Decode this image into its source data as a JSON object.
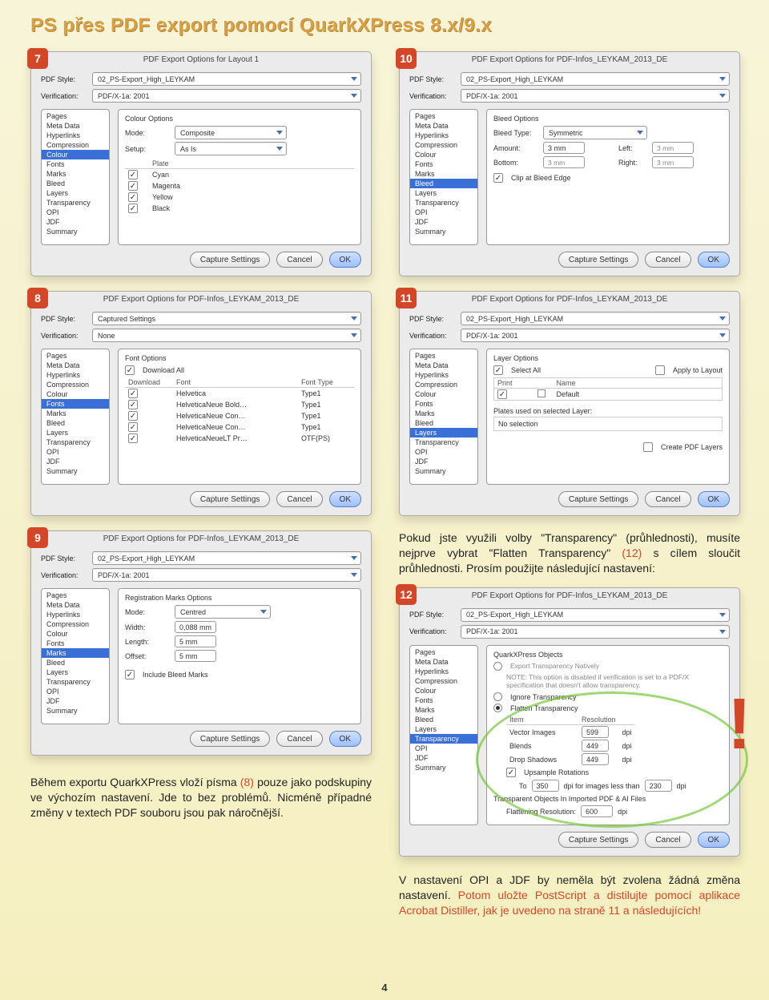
{
  "page_title": "PS přes PDF export pomocí QuarkXPress 8.x/9.x",
  "page_number": "4",
  "sidebar_items": [
    "Pages",
    "Meta Data",
    "Hyperlinks",
    "Compression",
    "Colour",
    "Fonts",
    "Marks",
    "Bleed",
    "Layers",
    "Transparency",
    "OPI",
    "JDF",
    "Summary"
  ],
  "pdfstyle_label": "PDF Style:",
  "verification_label": "Verification:",
  "style_02": "02_PS-Export_High_LEYKAM",
  "verif_pdfx": "PDF/X-1a: 2001",
  "captured_settings": "Captured Settings",
  "none": "None",
  "btn_capture": "Capture Settings",
  "btn_cancel": "Cancel",
  "btn_ok": "OK",
  "p7": {
    "title": "PDF Export Options for Layout 1",
    "group": "Colour Options",
    "mode_label": "Mode:",
    "mode_val": "Composite",
    "setup_label": "Setup:",
    "setup_val": "As Is",
    "plate_hdr": "Plate",
    "plates": [
      "Cyan",
      "Magenta",
      "Yellow",
      "Black"
    ]
  },
  "p8": {
    "title": "PDF Export Options for PDF-Infos_LEYKAM_2013_DE",
    "group": "Font Options",
    "download_all": "Download All",
    "hdr_download": "Download",
    "hdr_font": "Font",
    "hdr_type": "Font Type",
    "fonts": [
      {
        "f": "Helvetica",
        "t": "Type1"
      },
      {
        "f": "HelveticaNeue Bold…",
        "t": "Type1"
      },
      {
        "f": "HelveticaNeue Con…",
        "t": "Type1"
      },
      {
        "f": "HelveticaNeue Con…",
        "t": "Type1"
      },
      {
        "f": "HelveticaNeueLT Pr…",
        "t": "OTF(PS)"
      }
    ]
  },
  "p9": {
    "title": "PDF Export Options for PDF-Infos_LEYKAM_2013_DE",
    "group": "Registration Marks Options",
    "mode_label": "Mode:",
    "mode_val": "Centred",
    "width_label": "Width:",
    "width_val": "0,088 mm",
    "length_label": "Length:",
    "length_val": "5 mm",
    "offset_label": "Offset:",
    "offset_val": "5 mm",
    "include_bleed": "Include Bleed Marks"
  },
  "p10": {
    "title": "PDF Export Options for PDF-Infos_LEYKAM_2013_DE",
    "group": "Bleed Options",
    "bleedtype_label": "Bleed Type:",
    "bleedtype_val": "Symmetric",
    "amount_label": "Amount:",
    "amount_val": "3 mm",
    "left_label": "Left:",
    "left_val": "3 mm",
    "bottom_label": "Bottom:",
    "bottom_val": "3 mm",
    "right_label": "Right:",
    "right_val": "3 mm",
    "clip": "Clip at Bleed Edge"
  },
  "p11": {
    "title": "PDF Export Options for PDF-Infos_LEYKAM_2013_DE",
    "group": "Layer Options",
    "select_all": "Select All",
    "apply": "Apply to Layout",
    "hdr_print": "Print",
    "hdr_name": "Name",
    "default": "Default",
    "plates_used": "Plates used on selected Layer:",
    "no_sel": "No selection",
    "create_pdf_layers": "Create PDF Layers"
  },
  "p12": {
    "title": "PDF Export Options for PDF-Infos_LEYKAM_2013_DE",
    "group": "QuarkXPress Objects",
    "opt_native": "Export Transparency Natively",
    "note": "NOTE: This option is disabled if verification is set to a PDF/X specification that doesn't allow transparency.",
    "opt_ignore": "Ignore Transparency",
    "opt_flatten": "Flatten Transparency",
    "hdr_item": "Item",
    "hdr_res": "Resolution",
    "rows_items": [
      "Vector Images",
      "Blends",
      "Drop Shadows"
    ],
    "rows_vals": [
      "599",
      "449",
      "449"
    ],
    "dpi": "dpi",
    "upsample": "Upsample Rotations",
    "to": "To",
    "to_val": "350",
    "for_label": "dpi for images less than",
    "for_val": "230",
    "trans_imported": "Transparent Objects In Imported PDF & AI Files",
    "flatres_label": "Flattening Resolution:",
    "flatres_val": "600"
  },
  "para1a": "Pokud jste využili volby \"Transparency\" (průhlednosti), musíte nejprve vybrat \"Flatten Transparency\" ",
  "para1ref": "(12)",
  "para1b": " s cílem sloučit průhlednosti. Prosím použijte následující nastavení:",
  "para2a": "Během exportu QuarkXPress vloží písma ",
  "para2ref": "(8)",
  "para2b": " pouze jako podskupiny ve výchozím nastavení. Jde to bez problémů. Nicméně případné změny v textech PDF souboru jsou pak náročnější.",
  "para3a": "V nastavení OPI a JDF by neměla být zvolena žádná změna nastavení. ",
  "para3b": "Potom uložte PostScript a distilujte pomocí aplikace Acrobat Distiller, jak je uvedeno na straně 11 a následujících!"
}
